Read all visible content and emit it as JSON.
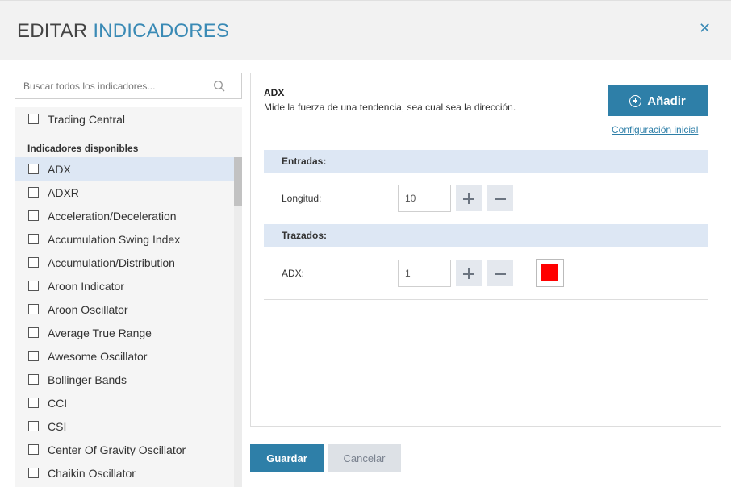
{
  "header": {
    "title_part1": "EDITAR",
    "title_part2": "INDICADORES",
    "close_glyph": "✕"
  },
  "search": {
    "placeholder": "Buscar todos los indicadores...",
    "icon": "search-icon"
  },
  "list": {
    "pinned": [
      {
        "label": "Trading Central",
        "checked": false
      }
    ],
    "section_label": "Indicadores disponibles",
    "items": [
      {
        "label": "ADX",
        "checked": false,
        "selected": true
      },
      {
        "label": "ADXR",
        "checked": false
      },
      {
        "label": "Acceleration/Deceleration",
        "checked": false
      },
      {
        "label": "Accumulation Swing Index",
        "checked": false
      },
      {
        "label": "Accumulation/Distribution",
        "checked": false
      },
      {
        "label": "Aroon Indicator",
        "checked": false
      },
      {
        "label": "Aroon Oscillator",
        "checked": false
      },
      {
        "label": "Average True Range",
        "checked": false
      },
      {
        "label": "Awesome Oscillator",
        "checked": false
      },
      {
        "label": "Bollinger Bands",
        "checked": false
      },
      {
        "label": "CCI",
        "checked": false
      },
      {
        "label": "CSI",
        "checked": false
      },
      {
        "label": "Center Of Gravity Oscillator",
        "checked": false
      },
      {
        "label": "Chaikin Oscillator",
        "checked": false
      }
    ]
  },
  "detail": {
    "name": "ADX",
    "description": "Mide la fuerza de una tendencia, sea cual sea la dirección.",
    "add_label": "Añadir",
    "config_link": "Configuración inicial",
    "inputs_header": "Entradas:",
    "inputs": [
      {
        "label": "Longitud:",
        "value": "10"
      }
    ],
    "plots_header": "Trazados:",
    "plots": [
      {
        "label": "ADX:",
        "value": "1",
        "color": "#ff0000"
      }
    ]
  },
  "footer": {
    "save_label": "Guardar",
    "cancel_label": "Cancelar"
  },
  "colors": {
    "accent": "#2e7fa8",
    "title_accent": "#3a8ab5",
    "selected_row": "#dde7f4",
    "plot_color": "#ff0000"
  }
}
